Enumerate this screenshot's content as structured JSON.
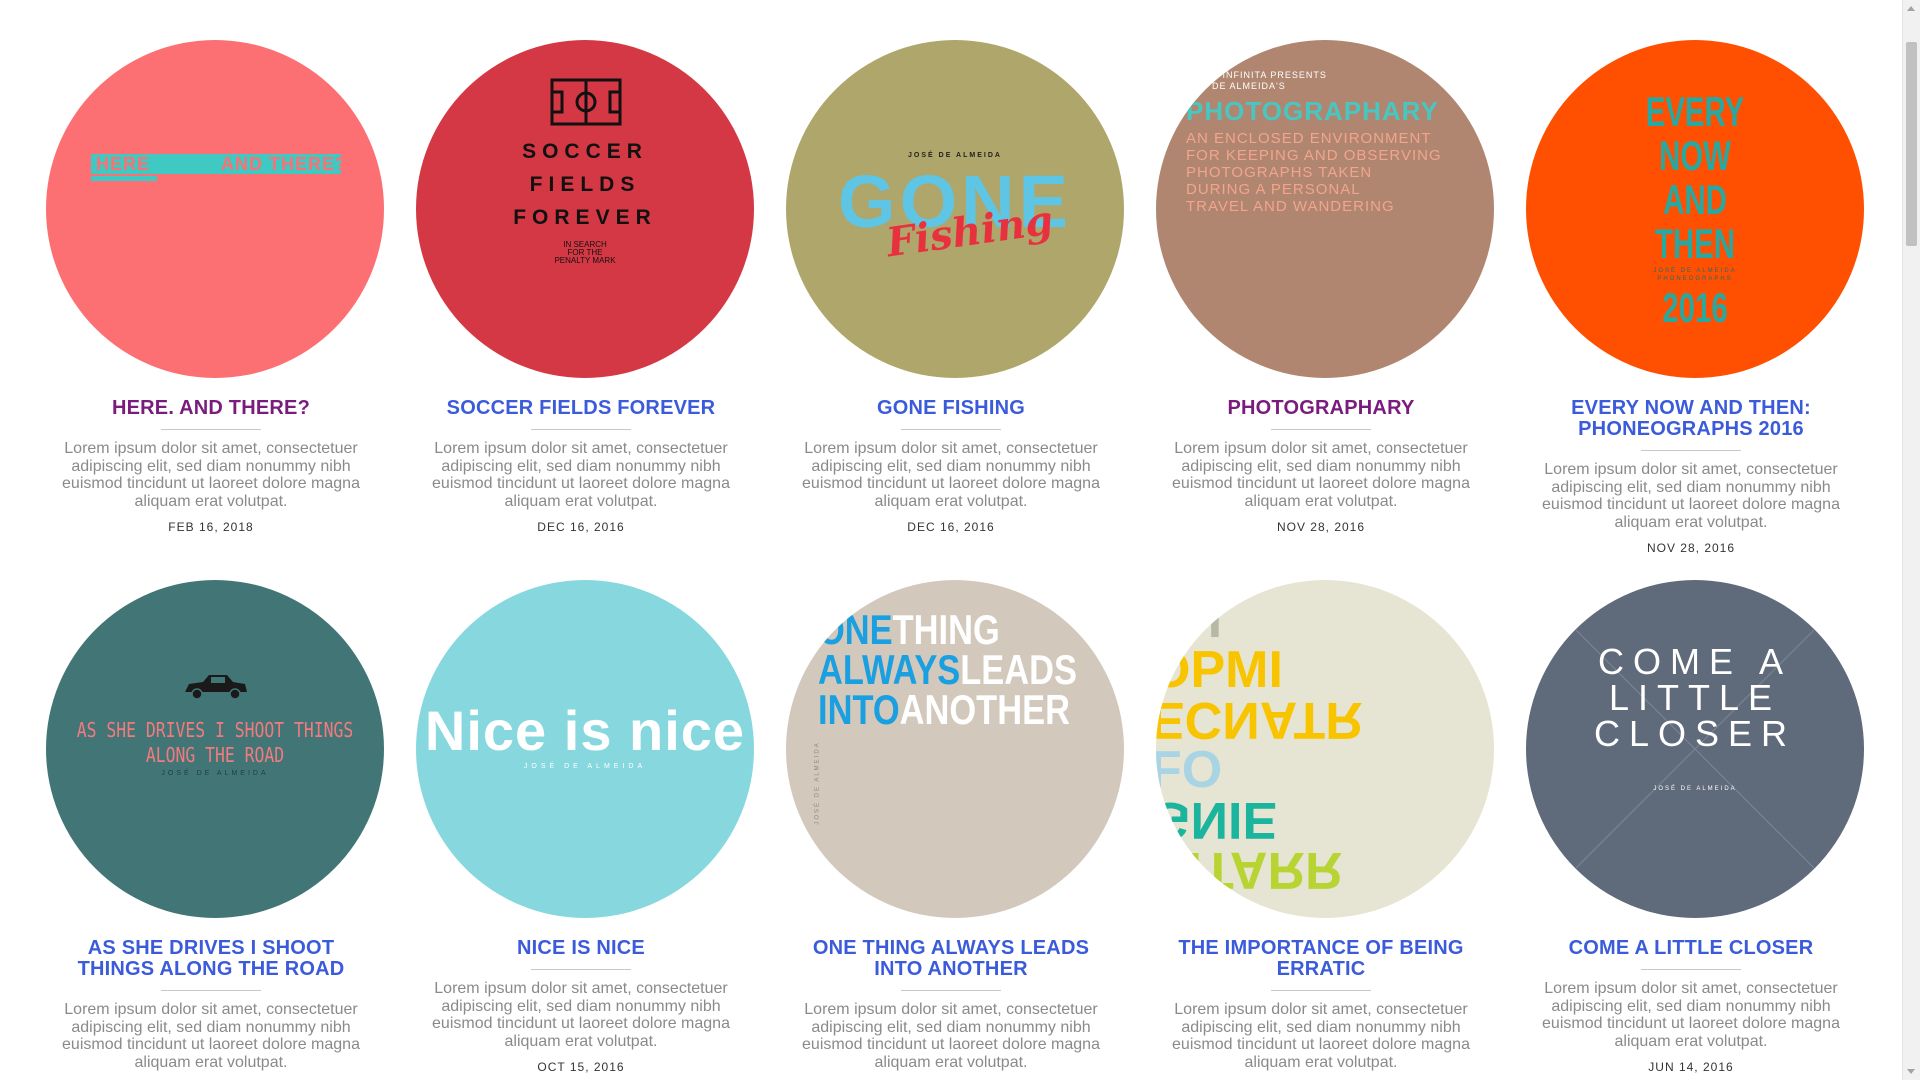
{
  "colors": {
    "title_blue": "#3b5bdb",
    "title_purple": "#7a1b7e",
    "excerpt_gray": "#8a8a8a"
  },
  "posts": [
    {
      "title": "HERE. AND THERE?",
      "excerpt": "Lorem ipsum dolor sit amet, consectetuer adipiscing elit, sed diam nonummy nibh euismod tincidunt ut laoreet dolore magna aliquam erat volutpat.",
      "date": "FEB 16, 2018",
      "circle_color": "#fc7073",
      "art": {
        "line1": "HERE",
        "line2": "AND THERE?"
      }
    },
    {
      "title": "SOCCER FIELDS FOREVER",
      "excerpt": "Lorem ipsum dolor sit amet, consectetuer adipiscing elit, sed diam nonummy nibh euismod tincidunt ut laoreet dolore magna aliquam erat volutpat.",
      "date": "DEC 16, 2016",
      "circle_color": "#d43844",
      "art": {
        "line1": "SOCCER",
        "line2": "FIELDS",
        "line3": "FOREVER",
        "line4": "IN SEARCH",
        "line5": "FOR THE",
        "line6": "PENALTY MARK"
      }
    },
    {
      "title": "GONE FISHING",
      "excerpt": "Lorem ipsum dolor sit amet, consectetuer adipiscing elit, sed diam nonummy nibh euismod tincidunt ut laoreet dolore magna aliquam erat volutpat.",
      "date": "DEC 16, 2016",
      "circle_color": "#aea66a",
      "art": {
        "line1": "JOSÉ DE ALMEIDA",
        "line2": "GONE",
        "line3": "Fishing"
      }
    },
    {
      "title": "PHOTOGRAPHARY",
      "excerpt": "Lorem ipsum dolor sit amet, consectetuer adipiscing elit, sed diam nonummy nibh euismod tincidunt ut laoreet dolore magna aliquam erat volutpat.",
      "date": "NOV 28, 2016",
      "circle_color": "#b08670",
      "art": {
        "line1": "E INFINITA PRESENTS",
        "line2": "DE ALMEIDA'S",
        "line3": "PHOTOGRAPHARY",
        "line4": "AN ENCLOSED ENVIRONMENT",
        "line5": "FOR KEEPING AND OBSERVING",
        "line6": "PHOTOGRAPHS TAKEN",
        "line7": "DURING A PERSONAL",
        "line8": "TRAVEL AND WANDERING"
      }
    },
    {
      "title": "EVERY NOW AND THEN: PHONEOGRAPHS 2016",
      "excerpt": "Lorem ipsum dolor sit amet, consectetuer adipiscing elit, sed diam nonummy nibh euismod tincidunt ut laoreet dolore magna aliquam erat volutpat.",
      "date": "NOV 28, 2016",
      "circle_color": "#fe5000",
      "art": {
        "line1": "EVERY",
        "line2": "NOW",
        "line3": "AND",
        "line4": "THEN",
        "line5": "JOSÉ DE ALMEIDA",
        "line6": "PHONEOGRAPHS",
        "line7": "2016"
      }
    },
    {
      "title": "AS SHE DRIVES I SHOOT THINGS ALONG THE ROAD",
      "excerpt": "Lorem ipsum dolor sit amet, consectetuer adipiscing elit, sed diam nonummy nibh euismod tincidunt ut laoreet dolore magna aliquam erat volutpat.",
      "date": "",
      "circle_color": "#427676",
      "art": {
        "line1": "AS SHE DRIVES I SHOOT THINGS",
        "line2": "ALONG THE ROAD",
        "line3": "JOSÉ DE ALMEIDA"
      }
    },
    {
      "title": "NICE IS NICE",
      "excerpt": "Lorem ipsum dolor sit amet, consectetuer adipiscing elit, sed diam nonummy nibh euismod tincidunt ut laoreet dolore magna aliquam erat volutpat.",
      "date": "OCT 15, 2016",
      "circle_color": "#86d8de",
      "art": {
        "line1": "Nice is nice",
        "line2": "JOSÉ DE ALMEIDA"
      }
    },
    {
      "title": "ONE THING ALWAYS LEADS INTO ANOTHER",
      "excerpt": "Lorem ipsum dolor sit amet, consectetuer adipiscing elit, sed diam nonummy nibh euismod tincidunt ut laoreet dolore magna aliquam erat volutpat.",
      "date": "",
      "circle_color": "#d2c8bc",
      "art": {
        "a1": "ONE",
        "a2": "THING",
        "b1": "ALWAYS",
        "b2": "LEADS",
        "c1": "INTO",
        "c2": "ANOTHER",
        "side": "JOSÉ DE ALMEIDA"
      }
    },
    {
      "title": "THE IMPORTANCE OF BEING ERRATIC",
      "excerpt": "Lorem ipsum dolor sit amet, consectetuer adipiscing elit, sed diam nonummy nibh euismod tincidunt ut laoreet dolore magna aliquam erat volutpat.",
      "date": "",
      "circle_color": "#e6e4d2",
      "art": {
        "l1": "EH",
        "l2": "OPMI",
        "l3": "ECNATR",
        "l4": "FO",
        "l5": "GNIE",
        "l6": "CITARR"
      }
    },
    {
      "title": "COME A LITTLE CLOSER",
      "excerpt": "Lorem ipsum dolor sit amet, consectetuer adipiscing elit, sed diam nonummy nibh euismod tincidunt ut laoreet dolore magna aliquam erat volutpat.",
      "date": "JUN 14, 2016",
      "circle_color": "#5f6a7a",
      "art": {
        "line1": "COME A",
        "line2": "LITTLE",
        "line3": "CLOSER",
        "line4": "JOSÉ DE ALMEIDA"
      }
    }
  ]
}
